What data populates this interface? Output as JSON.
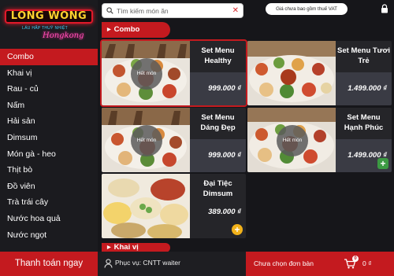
{
  "logo": {
    "text": "LONG WONG",
    "subtitle": "LẨU HẤP THUỶ NHIỆT",
    "script": "Hongkong"
  },
  "sidebar": {
    "items": [
      {
        "label": "Combo",
        "active": true
      },
      {
        "label": "Khai vị"
      },
      {
        "label": "Rau - củ"
      },
      {
        "label": "Nấm"
      },
      {
        "label": "Hải sản"
      },
      {
        "label": "Dimsum"
      },
      {
        "label": "Món gà - heo"
      },
      {
        "label": "Thịt bò"
      },
      {
        "label": "Đồ viên"
      },
      {
        "label": "Trà trái cây"
      },
      {
        "label": "Nước hoa quả"
      },
      {
        "label": "Nước ngọt"
      }
    ],
    "pay_button": "Thanh toán ngay"
  },
  "search": {
    "placeholder": "Tìm kiếm món ăn",
    "value": ""
  },
  "vat_note": "Giá chưa bao gồm thuế VAT",
  "sections": [
    {
      "title": "Combo"
    },
    {
      "title": "Khai vị"
    }
  ],
  "products": [
    {
      "name": "Set Menu Healthy",
      "price": "999.000 ₫",
      "status": "Hết món",
      "selected": true
    },
    {
      "name": "Set Menu Tươi Trẻ",
      "price": "1.499.000 ₫",
      "status": ""
    },
    {
      "name": "Set Menu Dáng Đẹp",
      "price": "999.000 ₫",
      "status": "Hết món"
    },
    {
      "name": "Set Menu Hạnh Phúc",
      "price": "1.499.000 ₫",
      "status": "Hết món"
    },
    {
      "name": "Đại Tiệc Dimsum",
      "price": "389.000 ₫",
      "status": ""
    }
  ],
  "footer": {
    "server": "Phục vụ: CNTT waiter",
    "order_status": "Chưa chọn đơn bàn",
    "cart_count": "0",
    "cart_total": "0 ₫"
  },
  "colors": {
    "accent": "#c41a1f",
    "background": "#16161a",
    "card": "#252529",
    "add_button": "#f2b21a"
  }
}
